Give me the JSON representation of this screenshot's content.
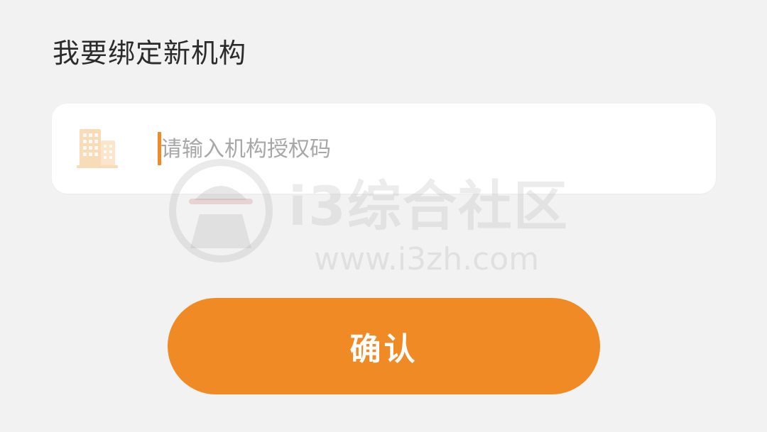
{
  "page": {
    "title": "我要绑定新机构"
  },
  "form": {
    "input_placeholder": "请输入机构授权码",
    "input_value": "",
    "input_icon": "building-icon",
    "confirm_label": "确认"
  },
  "watermark": {
    "text": "i3综合社区",
    "url": "www.i3zh.com"
  },
  "colors": {
    "accent": "#f08a24",
    "background": "#f2f2f2",
    "card": "#ffffff",
    "icon": "#f8dcb8"
  }
}
